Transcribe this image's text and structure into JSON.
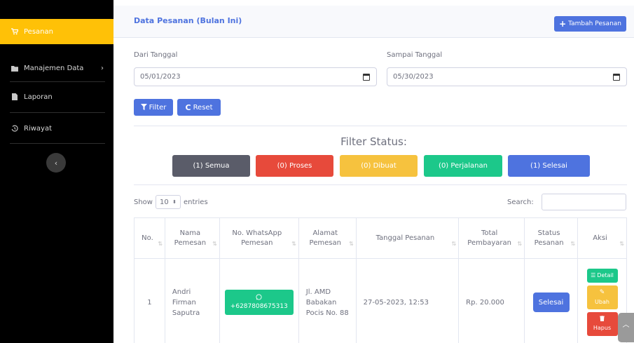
{
  "sidebar": {
    "items": [
      {
        "label": "Pesanan",
        "icon": "cart-icon"
      },
      {
        "label": "Manajemen Data",
        "icon": "folder-icon"
      },
      {
        "label": "Laporan",
        "icon": "file-icon"
      },
      {
        "label": "Riwayat",
        "icon": "history-icon"
      }
    ],
    "toggle": "‹"
  },
  "header": {
    "title": "Data Pesanan (Bulan Ini)",
    "add_label": "Tambah Pesanan"
  },
  "filter": {
    "from_label": "Dari Tanggal",
    "from_value": "05/01/2023",
    "to_label": "Sampai Tanggal",
    "to_value": "05/30/2023",
    "filter_button": "Filter",
    "reset_button": "Reset"
  },
  "status": {
    "heading": "Filter Status:",
    "chips": [
      {
        "label": "(1) Semua",
        "color": "#5a5c69"
      },
      {
        "label": "(0) Proses",
        "color": "#e74a3b"
      },
      {
        "label": "(0) Dibuat",
        "color": "#f6c23e"
      },
      {
        "label": "(0) Perjalanan",
        "color": "#1cc88a"
      },
      {
        "label": "(1) Selesai",
        "color": "#4e73df"
      }
    ]
  },
  "table_controls": {
    "show_label": "Show",
    "entries_value": "10",
    "entries_label": "entries",
    "search_label": "Search:"
  },
  "table": {
    "headers": [
      "No.",
      "Nama Pemesan",
      "No. WhatsApp Pemesan",
      "Alamat Pemesan",
      "Tanggal Pesanan",
      "Total Pembayaran",
      "Status Pesanan",
      "Aksi"
    ],
    "rows": [
      {
        "no": "1",
        "nama": "Andri Firman Saputra",
        "whatsapp": "+6287808675313",
        "alamat": "Jl. AMD Babakan Pocis No. 88",
        "tanggal": "27-05-2023, 12:53",
        "total": "Rp. 20.000",
        "status": "Selesai",
        "aksi": {
          "detail": "Detail",
          "ubah": "Ubah",
          "hapus": "Hapus"
        }
      }
    ]
  },
  "colors": {
    "primary": "#4e73df",
    "success": "#1cc88a",
    "warning": "#f6c23e",
    "danger": "#e74a3b",
    "sidebar_active": "#ffc107"
  }
}
